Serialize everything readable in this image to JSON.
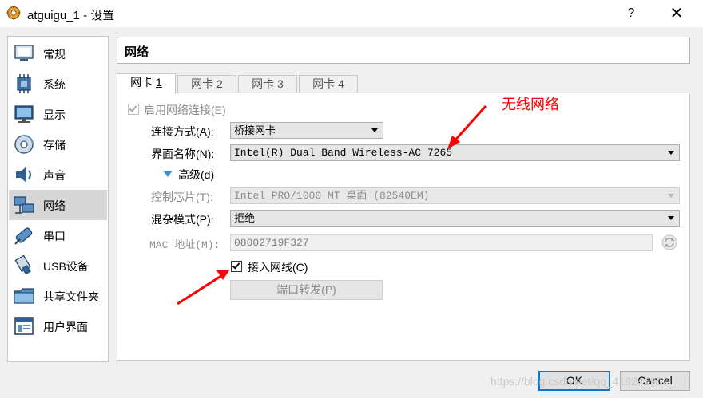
{
  "window": {
    "title": "atguigu_1 - 设置",
    "help_label": "?",
    "close_label": "✕"
  },
  "sidebar": {
    "items": [
      {
        "label": "常规",
        "icon": "general-icon"
      },
      {
        "label": "系统",
        "icon": "system-icon"
      },
      {
        "label": "显示",
        "icon": "display-icon"
      },
      {
        "label": "存储",
        "icon": "storage-icon"
      },
      {
        "label": "声音",
        "icon": "audio-icon"
      },
      {
        "label": "网络",
        "icon": "network-icon",
        "selected": true
      },
      {
        "label": "串口",
        "icon": "serial-port-icon"
      },
      {
        "label": "USB设备",
        "icon": "usb-icon"
      },
      {
        "label": "共享文件夹",
        "icon": "shared-folder-icon"
      },
      {
        "label": "用户界面",
        "icon": "user-interface-icon"
      }
    ]
  },
  "page": {
    "title": "网络"
  },
  "tabs": [
    {
      "label": "网卡 ",
      "num": "1",
      "active": true
    },
    {
      "label": "网卡 ",
      "num": "2"
    },
    {
      "label": "网卡 ",
      "num": "3"
    },
    {
      "label": "网卡 ",
      "num": "4"
    }
  ],
  "form": {
    "enable_adapter": {
      "label": "启用网络连接(E)",
      "checked": true
    },
    "attached_to": {
      "label": "连接方式(A):",
      "value": "桥接网卡"
    },
    "name": {
      "label": "界面名称(N):",
      "value": "Intel(R) Dual Band Wireless-AC 7265"
    },
    "advanced": {
      "label": "高级(d)"
    },
    "adapter_type": {
      "label": "控制芯片(T):",
      "value": "Intel PRO/1000 MT 桌面 (82540EM)"
    },
    "promiscuous": {
      "label": "混杂模式(P):",
      "value": "拒绝"
    },
    "mac": {
      "label": "MAC 地址(M):",
      "value": "08002719F327"
    },
    "cable_connected": {
      "label": "接入网线(C)",
      "checked": true
    },
    "port_forwarding": {
      "label": "端口转发(P)"
    }
  },
  "annotation": {
    "text": "无线网络",
    "color": "#ff0000"
  },
  "buttons": {
    "ok": "OK",
    "cancel": "Cancel"
  },
  "watermark": "https://blog.csdn.net/qq_41924190"
}
